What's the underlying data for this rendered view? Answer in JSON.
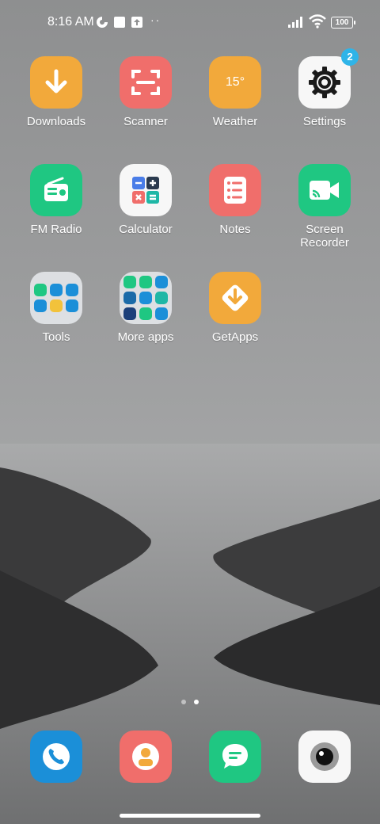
{
  "status_bar": {
    "time": "8:16 AM",
    "battery": "100",
    "more_dots": "··"
  },
  "apps": [
    {
      "label": "Downloads",
      "icon": "download-arrow-icon",
      "color": "#f2a93b"
    },
    {
      "label": "Scanner",
      "icon": "scan-frame-icon",
      "color": "#f06e6b"
    },
    {
      "label": "Weather",
      "icon": "weather-temp-icon",
      "color": "#f2a93b",
      "temp": "15°"
    },
    {
      "label": "Settings",
      "icon": "gear-icon",
      "color": "#f7f7f7",
      "badge": "2"
    },
    {
      "label": "FM Radio",
      "icon": "radio-icon",
      "color": "#1fc782"
    },
    {
      "label": "Calculator",
      "icon": "calculator-icon",
      "color": "#f7f7f7"
    },
    {
      "label": "Notes",
      "icon": "notes-list-icon",
      "color": "#f06e6b"
    },
    {
      "label": "Screen Recorder",
      "label_line1": "Screen",
      "label_line2": "Recorder",
      "icon": "video-cast-icon",
      "color": "#1fc782"
    },
    {
      "label": "Tools",
      "icon": "folder-icon"
    },
    {
      "label": "More apps",
      "icon": "folder-icon"
    },
    {
      "label": "GetApps",
      "icon": "getapps-icon",
      "color": "#f2a93b"
    }
  ],
  "dock": [
    {
      "name": "Phone",
      "icon": "phone-icon",
      "color": "#1b8fd8"
    },
    {
      "name": "Contacts",
      "icon": "contact-person-icon",
      "color": "#f06e6b"
    },
    {
      "name": "Messages",
      "icon": "chat-bubble-icon",
      "color": "#1fc782"
    },
    {
      "name": "Camera",
      "icon": "camera-lens-icon",
      "color": "#f7f7f7"
    }
  ]
}
